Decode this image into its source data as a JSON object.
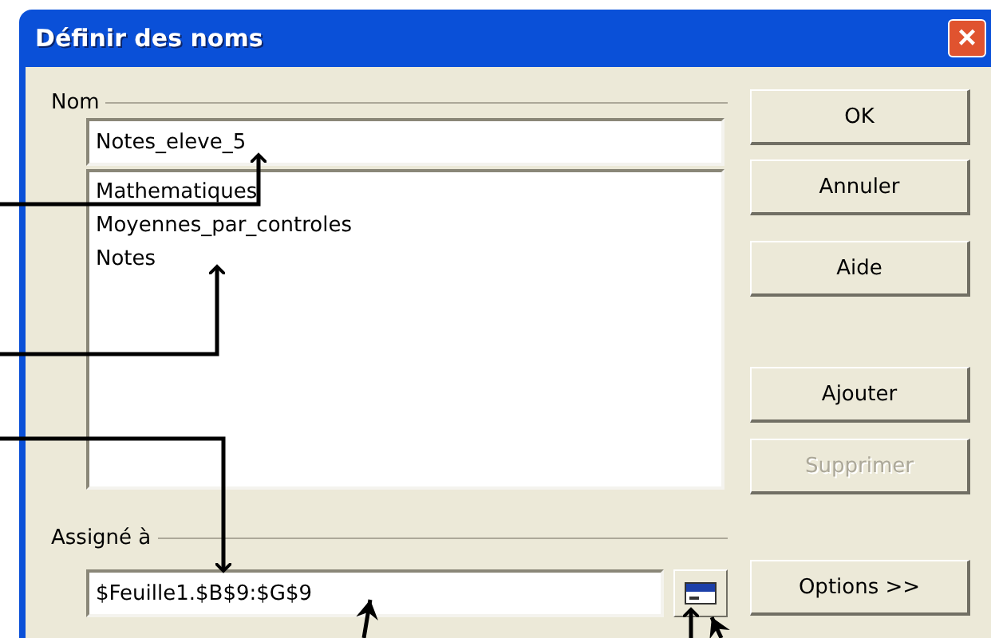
{
  "window": {
    "title": "Définir des noms",
    "close": "×"
  },
  "name_group": {
    "label": "Nom",
    "field_value": "Notes_eleve_5",
    "names": [
      {
        "label": "Mathematiques",
        "selected": false
      },
      {
        "label": "Moyennes_par_controles",
        "selected": false
      },
      {
        "label": "Notes",
        "selected": false
      }
    ]
  },
  "assigned_group": {
    "label": "Assigné à",
    "field_value": "$Feuille1.$B$9:$G$9"
  },
  "buttons": [
    {
      "label": "OK",
      "disabled": false
    },
    {
      "label": "Annuler",
      "disabled": false
    },
    {
      "label": "Aide",
      "disabled": false
    },
    {
      "label": "Ajouter",
      "disabled": false
    },
    {
      "label": "Supprimer",
      "disabled": true
    },
    {
      "label": "Options >>",
      "disabled": false
    }
  ]
}
